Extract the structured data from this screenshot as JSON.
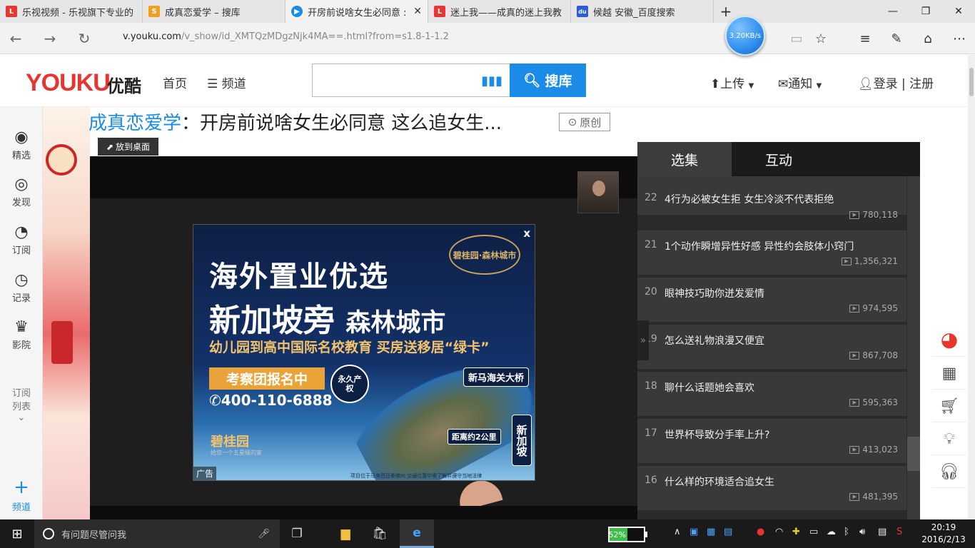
{
  "browser": {
    "tabs": [
      {
        "label": "乐视视频 - 乐视旗下专业的",
        "icon": "letv-icon",
        "color": "#e8352f",
        "glyph": "L"
      },
      {
        "label": "成真恋爱学 – 搜库",
        "icon": "soku-icon",
        "color": "#f0a020",
        "glyph": "S"
      },
      {
        "label": "开房前说啥女生必同意 :",
        "icon": "youku-play-icon",
        "color": "#1a8be6",
        "glyph": "▶"
      },
      {
        "label": "迷上我——成真的迷上我教",
        "icon": "letv-icon",
        "color": "#e8352f",
        "glyph": "L"
      },
      {
        "label": "候越 安徽_百度搜索",
        "icon": "baidu-icon",
        "color": "#2e5bd8",
        "glyph": "du"
      }
    ],
    "new_tab": "+",
    "url_prefix": "v.youku.com",
    "url_rest": "/v_show/id_XMTQzMDgzNjk4MA==.html?from=s1.8-1-1.2",
    "speed": "3.20KB/s"
  },
  "youku": {
    "logo": "YOUKU",
    "logo_cn": "优酷",
    "nav_home": "首页",
    "nav_channel": "频道",
    "search_placeholder": "",
    "search_button": "搜库",
    "upload": "上传",
    "notify": "通知",
    "login": "登录",
    "register": "注册"
  },
  "sidebar": {
    "items": [
      "精选",
      "发现",
      "订阅",
      "记录",
      "影院"
    ],
    "sub_list_1": "订阅",
    "sub_list_2": "列表",
    "channel": "频道"
  },
  "video": {
    "channel_name": "成真恋爱学",
    "title_rest": "：开房前说啥女生必同意 这么追女生...",
    "original_tag": "原创",
    "to_desktop": "放到桌面"
  },
  "ad": {
    "close": "x",
    "line1": "海外置业优选",
    "line2a": "新加坡旁",
    "line2b": "森林城市",
    "line3": "幼儿园到高中国际名校教育 买房送移居“绿卡”",
    "brand_top": "碧桂园·森林城市",
    "tour": "考察团报名中",
    "phone": "✆400-110-6888",
    "badge": "永久产权",
    "bridge": "新马海关大桥",
    "distance": "距离约2公里",
    "sg": "新加坡",
    "brand": "碧桂园",
    "slogan": "给您一个五星级的家",
    "fine_print": "项目位于马来西亚柔佛州 交通位置中需了解并遵守当地法律",
    "label": "广告"
  },
  "playlist": {
    "tab_episodes": "选集",
    "tab_interact": "互动",
    "items": [
      {
        "num": "22",
        "title": "4行为必被女生拒 女生冷淡不代表拒绝",
        "plays": "780,118"
      },
      {
        "num": "21",
        "title": "1个动作瞬增异性好感 异性约会肢体小窍门",
        "plays": "1,356,321"
      },
      {
        "num": "20",
        "title": "眼神技巧助你迸发爱情",
        "plays": "974,595"
      },
      {
        "num": "19",
        "title": "怎么送礼物浪漫又便宜",
        "plays": "867,708"
      },
      {
        "num": "18",
        "title": "聊什么话题她会喜欢",
        "plays": "595,363"
      },
      {
        "num": "17",
        "title": "世界杯导致分手率上升?",
        "plays": "413,023"
      },
      {
        "num": "16",
        "title": "什么样的环境适合追女生",
        "plays": "481,395"
      }
    ]
  },
  "taskbar": {
    "search_placeholder": "有问题尽管问我",
    "battery": "52%",
    "battery_level": 0.52,
    "time": "20:19",
    "date": "2016/2/13"
  }
}
